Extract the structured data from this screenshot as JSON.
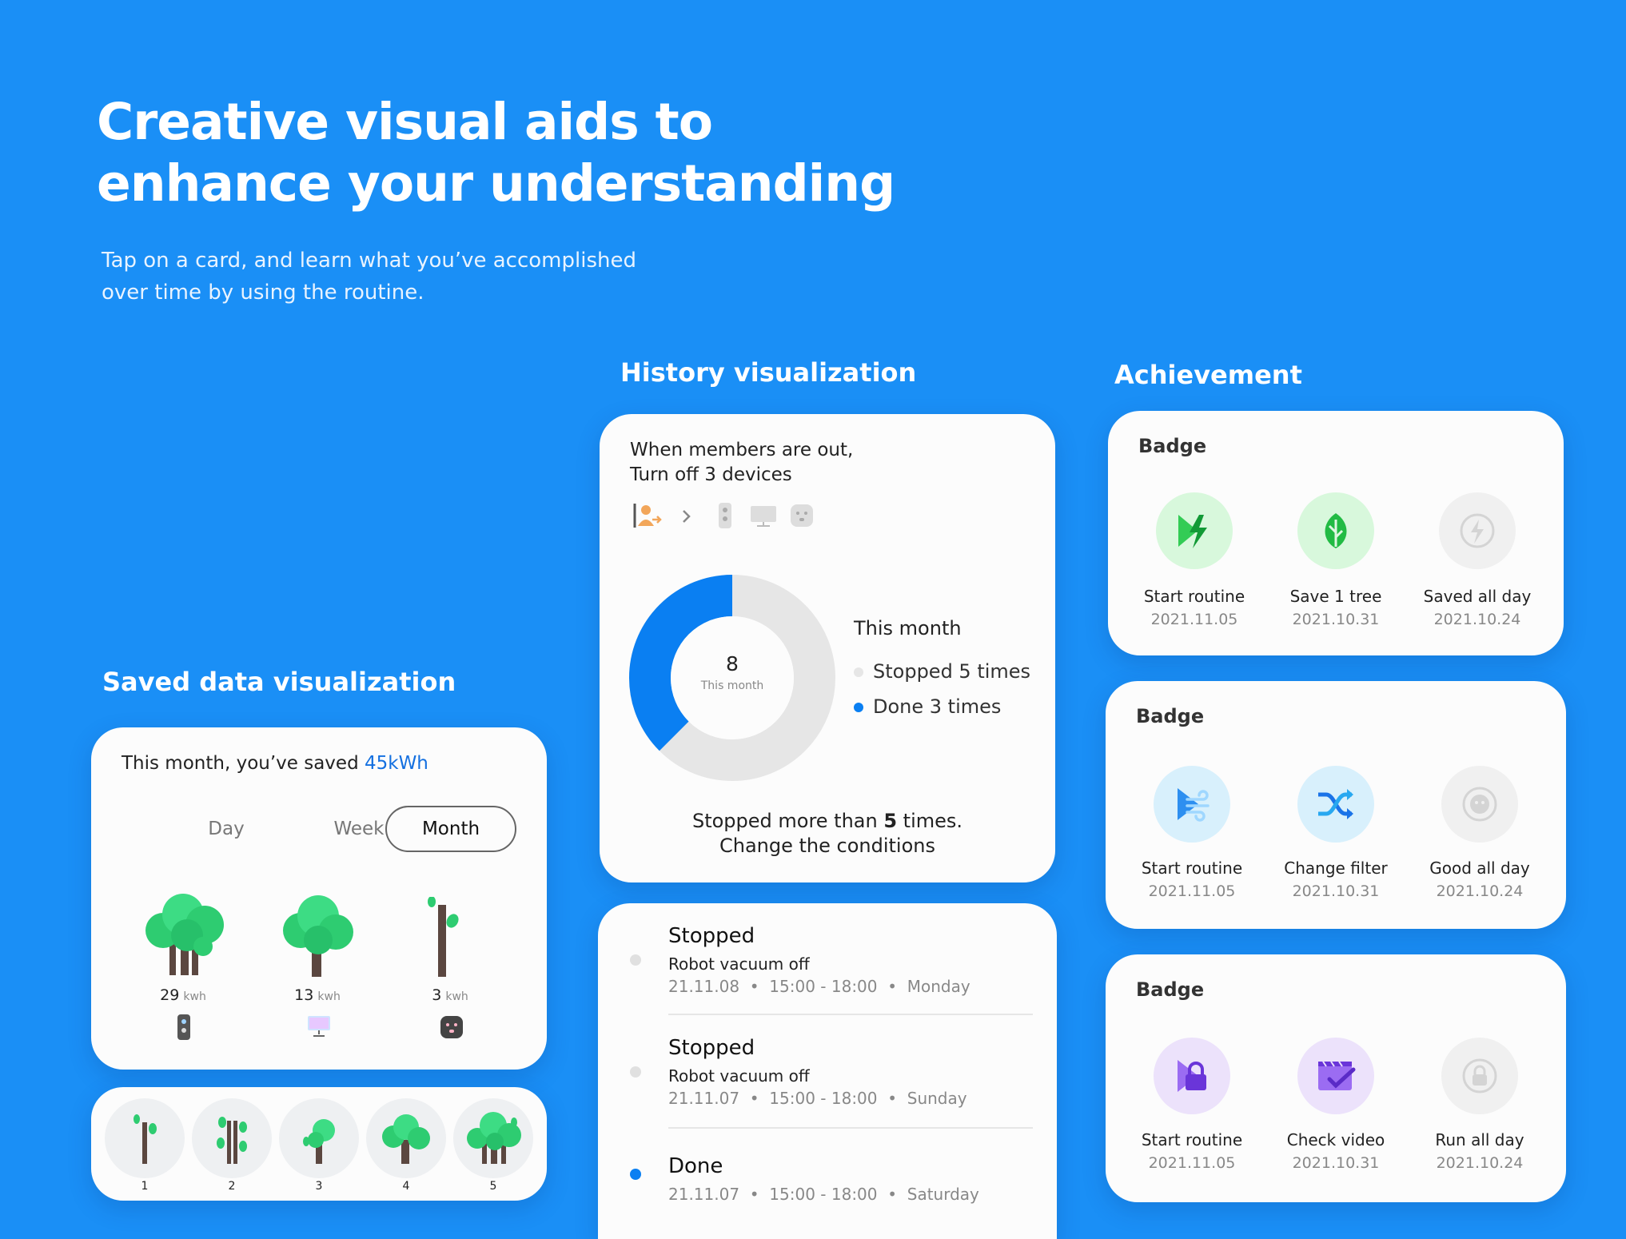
{
  "hero": {
    "title_line1": "Creative visual aids to",
    "title_line2": "enhance your understanding",
    "subtitle_line1": "Tap on a card, and learn what you’ve accomplished",
    "subtitle_line2": "over time by using the routine."
  },
  "sections": {
    "saved": "Saved data visualization",
    "history": "History visualization",
    "achievement": "Achievement"
  },
  "saved_card": {
    "headline_prefix": "This month, you’ve saved ",
    "headline_value": "45kWh",
    "tabs": [
      "Day",
      "Week",
      "Month"
    ],
    "active_tab": "Month",
    "items": [
      {
        "value": "29",
        "unit": "kwh",
        "device_icon": "air-purifier-icon"
      },
      {
        "value": "13",
        "unit": "kwh",
        "device_icon": "tv-icon"
      },
      {
        "value": "3",
        "unit": "kwh",
        "device_icon": "smart-plug-icon"
      }
    ]
  },
  "tree_levels": [
    "1",
    "2",
    "3",
    "4",
    "5"
  ],
  "history_card": {
    "title_line1": "When members are out,",
    "title_line2": "Turn off 3 devices",
    "donut_center_value": "8",
    "donut_center_label": "This month",
    "legend_title": "This month",
    "legend": [
      {
        "label": "Stopped 5 times",
        "color": "#e6e6e6"
      },
      {
        "label": "Done 3 times",
        "color": "#0a7ff2"
      }
    ],
    "footer_line1_prefix": "Stopped more than ",
    "footer_line1_bold": "5",
    "footer_line1_suffix": " times.",
    "footer_line2": "Change the conditions"
  },
  "chart_data": {
    "type": "pie",
    "categories": [
      "Stopped",
      "Done"
    ],
    "values": [
      5,
      3
    ],
    "title": "This month"
  },
  "log": [
    {
      "status": "Stopped",
      "desc": "Robot vacuum off",
      "date": "21.11.08",
      "time": "15:00 - 18:00",
      "day": "Monday",
      "dot": "#e0e0e0"
    },
    {
      "status": "Stopped",
      "desc": "Robot vacuum off",
      "date": "21.11.07",
      "time": "15:00 - 18:00",
      "day": "Sunday",
      "dot": "#e0e0e0"
    },
    {
      "status": "Done",
      "desc": "",
      "date": "21.11.07",
      "time": "15:00 - 18:00",
      "day": "Saturday",
      "dot": "#0a7ff2"
    }
  ],
  "badges": [
    {
      "title": "Badge",
      "items": [
        {
          "label": "Start routine",
          "date": "2021.11.05",
          "icon": "energy-play-icon"
        },
        {
          "label": "Save 1 tree",
          "date": "2021.10.31",
          "icon": "leaf-icon"
        },
        {
          "label": "Saved all day",
          "date": "2021.10.24",
          "icon": "energy-locked-icon"
        }
      ]
    },
    {
      "title": "Badge",
      "items": [
        {
          "label": "Start routine",
          "date": "2021.11.05",
          "icon": "air-play-icon"
        },
        {
          "label": "Change filter",
          "date": "2021.10.31",
          "icon": "shuffle-icon"
        },
        {
          "label": "Good all day",
          "date": "2021.10.24",
          "icon": "face-locked-icon"
        }
      ]
    },
    {
      "title": "Badge",
      "items": [
        {
          "label": "Start routine",
          "date": "2021.11.05",
          "icon": "lock-play-icon"
        },
        {
          "label": "Check video",
          "date": "2021.10.31",
          "icon": "video-check-icon"
        },
        {
          "label": "Run all day",
          "date": "2021.10.24",
          "icon": "lock-locked-icon"
        }
      ]
    }
  ],
  "sep": "•"
}
